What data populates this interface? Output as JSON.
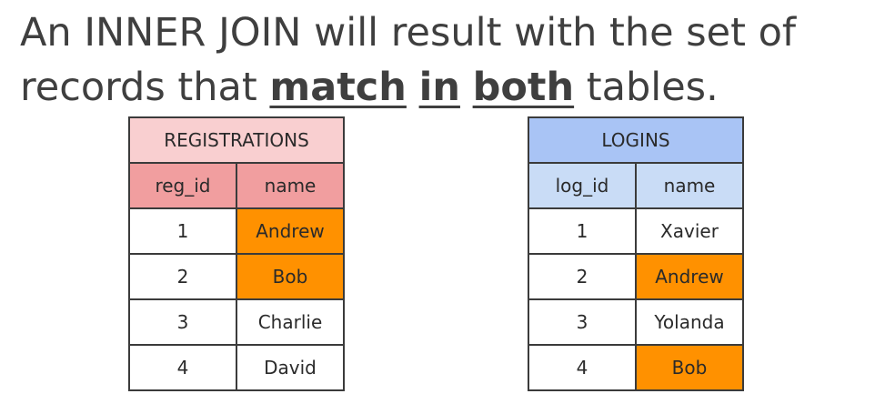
{
  "headline": {
    "line1": "An INNER JOIN will result with the set of",
    "line2_prefix": "records that ",
    "word_match": "match",
    "word_in": "in",
    "word_both": "both",
    "line2_suffix": " tables."
  },
  "registrations": {
    "title": "REGISTRATIONS",
    "columns": [
      "reg_id",
      "name"
    ],
    "rows": [
      {
        "id": "1",
        "name": "Andrew",
        "match": true
      },
      {
        "id": "2",
        "name": "Bob",
        "match": true
      },
      {
        "id": "3",
        "name": "Charlie",
        "match": false
      },
      {
        "id": "4",
        "name": "David",
        "match": false
      }
    ]
  },
  "logins": {
    "title": "LOGINS",
    "columns": [
      "log_id",
      "name"
    ],
    "rows": [
      {
        "id": "1",
        "name": "Xavier",
        "match": false
      },
      {
        "id": "2",
        "name": "Andrew",
        "match": true
      },
      {
        "id": "3",
        "name": "Yolanda",
        "match": false
      },
      {
        "id": "4",
        "name": "Bob",
        "match": true
      }
    ]
  },
  "colors": {
    "match_highlight": "#ff9100",
    "registrations_title": "#f9cfd0",
    "registrations_header": "#f19e9f",
    "logins_title": "#a9c4f5",
    "logins_header": "#c9dcf6"
  }
}
